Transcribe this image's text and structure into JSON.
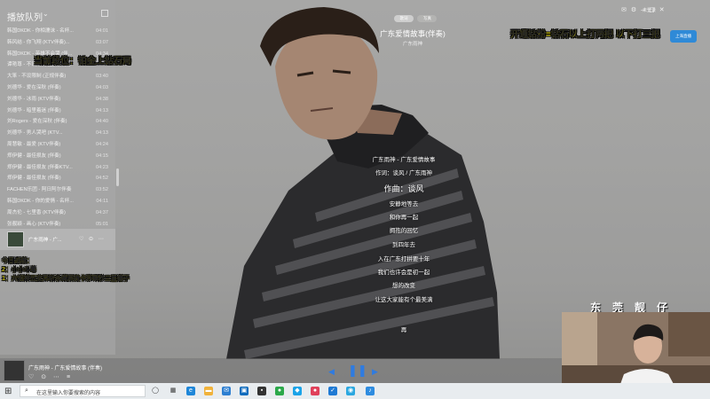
{
  "queue": {
    "title": "播放队列",
    "items": [
      {
        "title": "韩国DKDK - 你相濡沫 - 名杯...",
        "duration": "04:01"
      },
      {
        "title": "韩风结 - 你飞翔 (KTV伴奏)...",
        "duration": "03:07"
      },
      {
        "title": "韩国DKDK - 英雄不会哭 (伴...",
        "duration": "04:34"
      },
      {
        "title": "谭艳尊 - 不设限制 (正规伴奏)",
        "duration": "03:14"
      },
      {
        "title": "大笨 - 不设限制 (正规伴奏)",
        "duration": "03:40"
      },
      {
        "title": "刘德华 - 爱在深秋 (伴奏)",
        "duration": "04:03"
      },
      {
        "title": "刘德华 - 冰雨 (KTV伴奏)",
        "duration": "04:38"
      },
      {
        "title": "刘德华 - 暗里着迷 (伴奏)",
        "duration": "04:13"
      },
      {
        "title": "刘Rogers - 爱在深秋 (伴奏)",
        "duration": "04:40"
      },
      {
        "title": "刘德华 - 男人哭吧 (KTV...",
        "duration": "04:13"
      },
      {
        "title": "周慧敏 - 最爱 (KTV伴奏)",
        "duration": "04:24"
      },
      {
        "title": "郑伊健 - 最佳损友 (伴奏)",
        "duration": "04:15"
      },
      {
        "title": "郑伊健 - 最佳损友 (伴奏KTV...",
        "duration": "04:23"
      },
      {
        "title": "郑伊健 - 最佳损友 (伴奏)",
        "duration": "04:52"
      },
      {
        "title": "FACHEN乐团 - 阿日阿尔伴奏",
        "duration": "03:52"
      },
      {
        "title": "韩国DKDK - 你的爱情 - 名杯...",
        "duration": "04:11"
      },
      {
        "title": "周杰伦 - 七里香 (KTV伴奏)",
        "duration": "04:37"
      },
      {
        "title": "张靓颖 - 画心 (KTV伴奏)",
        "duration": "05:01"
      }
    ],
    "current": {
      "title": "广东雨神 - 广...",
      "icons": "♡ ⊙ ⋯"
    }
  },
  "overlays": {
    "rank": "当前段位：铂金上钻石局",
    "promo": "开通钻粉=钻石以上打两把 以下打三把",
    "stats_title": "今日战绩：",
    "stats_line1": "2：小小斗毒",
    "stats_line2": "1：六祖神五变异斩杀满屏流卡莎瞬秒三星德子",
    "cam_label": "东莞靓仔"
  },
  "header": {
    "tab_on": "歌词",
    "tab_off": "写真",
    "song_title": "广东爱情故事(伴奏)",
    "song_artist": "广东雨神",
    "login": "未登录",
    "mini_logo": "上海直播"
  },
  "lyrics": [
    "广东雨神 - 广东爱情故事",
    "作词：谈风 / 广东雨神",
    "作曲：谈风",
    "安静地等去",
    "和你再一起",
    "拥抱的回忆",
    "到四年去",
    "入在广东打拼要十年",
    "我们也许会是初一起",
    "想的改变",
    "让这大家能有个最美满",
    "再"
  ],
  "player": {
    "title": "广东雨神 - 广东爱情故事 (伴奏)",
    "icons": "♡ ⊙ ⋯ ≡"
  },
  "taskbar": {
    "search_placeholder": "在这里输入你要搜索的内容"
  },
  "colors": {
    "accent_blue": "#2f7be0",
    "overlay_yellow": "#fff200"
  }
}
